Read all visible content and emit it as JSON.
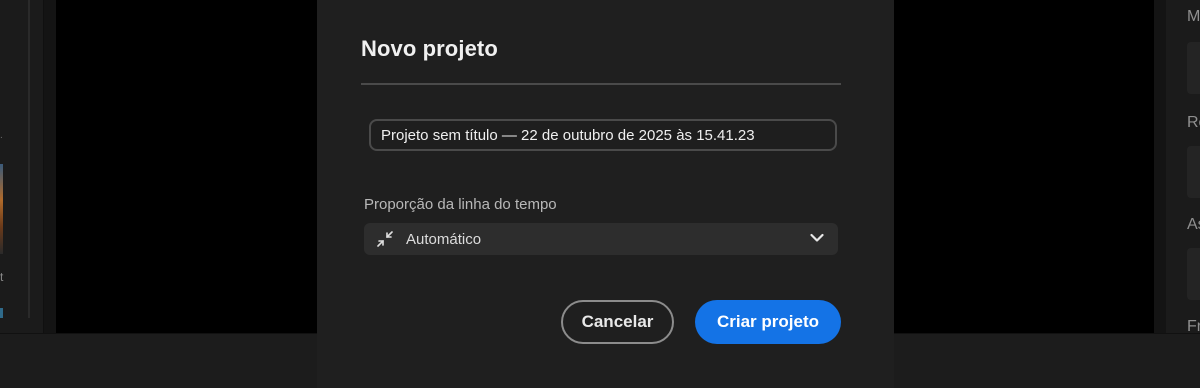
{
  "dialog": {
    "title": "Novo projeto",
    "project_name_value": "Projeto sem título — 22 de outubro de 2025 às 15.41.23",
    "timeline_label": "Proporção da linha do tempo",
    "timeline_selected": "Automático",
    "cancel_label": "Cancelar",
    "create_label": "Criar projeto"
  },
  "background": {
    "left_glyph": "t",
    "left_dot": ".",
    "right_labels": [
      "M",
      "Re",
      "As",
      "Fr"
    ]
  },
  "colors": {
    "accent": "#1473e6",
    "modal_bg": "#1f1f1f",
    "canvas_bg": "#000000"
  },
  "icons": {
    "timeline_select": "collapse-arrows-icon",
    "dropdown": "chevron-down-icon"
  }
}
